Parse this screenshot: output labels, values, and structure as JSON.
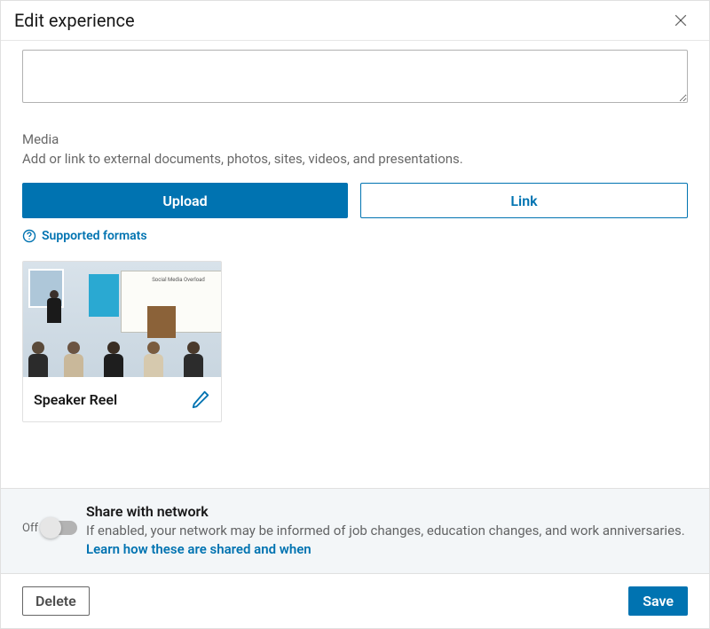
{
  "modal": {
    "title": "Edit experience"
  },
  "media": {
    "label": "Media",
    "helper": "Add or link to external documents, photos, sites, videos, and presentations.",
    "upload_label": "Upload",
    "link_label": "Link",
    "supported_formats_label": "Supported formats",
    "items": [
      {
        "title": "Speaker Reel",
        "thumb_screen_text": "Social Media Overload"
      }
    ]
  },
  "share": {
    "toggle_state_label": "Off",
    "title": "Share with network",
    "description_prefix": "If enabled, your network may be informed of job changes, education changes, and work anniversaries. ",
    "learn_more": "Learn how these are shared and when"
  },
  "footer": {
    "delete_label": "Delete",
    "save_label": "Save"
  }
}
